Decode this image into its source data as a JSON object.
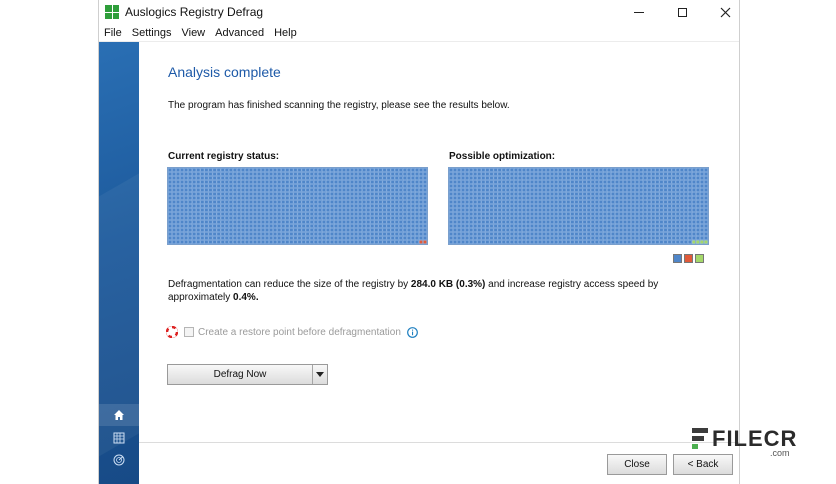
{
  "window": {
    "title": "Auslogics Registry Defrag",
    "controls": {
      "minimize": "minimize",
      "maximize": "maximize",
      "close": "close"
    }
  },
  "menu": [
    "File",
    "Settings",
    "View",
    "Advanced",
    "Help"
  ],
  "sidebar": {
    "items": [
      {
        "icon": "home-icon",
        "active": true
      },
      {
        "icon": "registry-icon",
        "active": false
      },
      {
        "icon": "radar-icon",
        "active": false
      }
    ]
  },
  "main": {
    "heading": "Analysis complete",
    "description": "The program has finished scanning the registry, please see the results below.",
    "current_label": "Current registry status:",
    "possible_label": "Possible optimization:",
    "grid": {
      "cols": 64,
      "rows": 19
    },
    "current_fragmented_cells": 2,
    "possible_free_cells": 4,
    "legend_colors": [
      "#4f86c9",
      "#e05a3a",
      "#a5d86a"
    ],
    "result_prefix": "Defragmentation can reduce the size of the registry by ",
    "result_size": "284.0 KB (0.3%)",
    "result_middle": " and increase registry access speed by approximately ",
    "result_speed": "0.4%",
    "result_suffix": ".",
    "restore_label": "Create a restore point before defragmentation",
    "defrag_button": "Defrag Now"
  },
  "footer": {
    "close_label": "Close",
    "back_label": "< Back"
  },
  "watermark": {
    "brand": "FILECR",
    "suffix": ".com"
  },
  "colors": {
    "accent": "#1e5aa8",
    "cell": "#4f86c9",
    "cell_border": "#a9c6ea",
    "fragment": "#e05a3a",
    "free": "#a5d86a"
  }
}
